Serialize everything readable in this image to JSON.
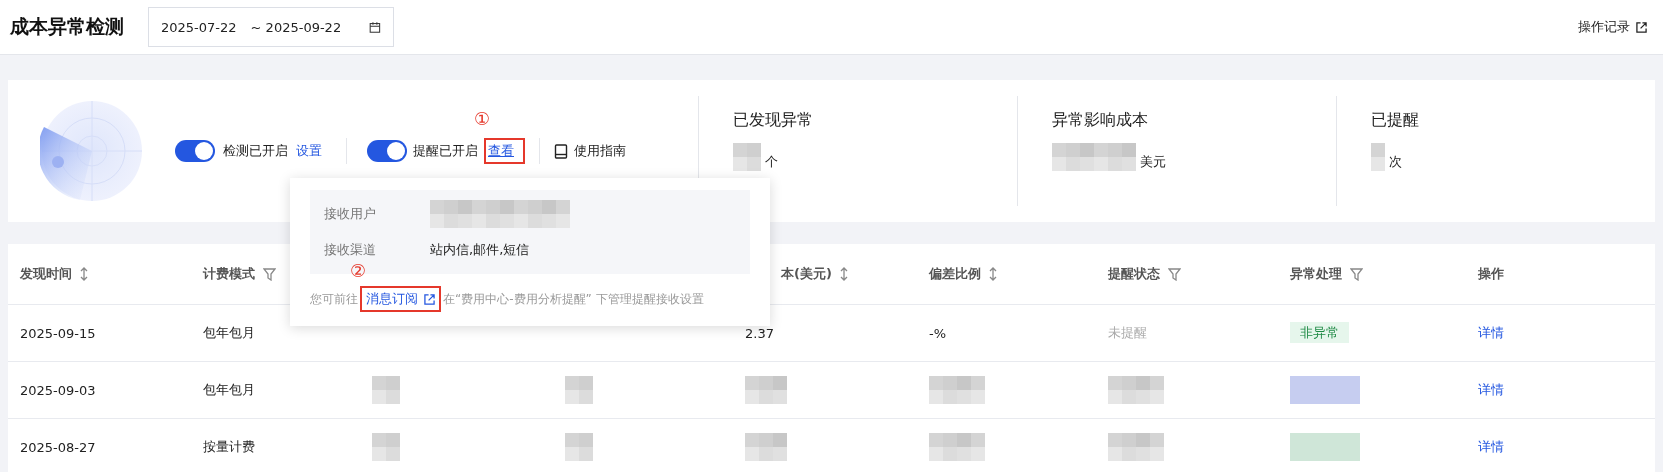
{
  "header": {
    "title": "成本异常检测",
    "date_range": {
      "start": "2025-07-22",
      "separator": "~",
      "end": "2025-09-22"
    },
    "log_link": "操作记录"
  },
  "summary": {
    "detection": {
      "on": true,
      "label": "检测已开启",
      "link": "设置"
    },
    "reminder": {
      "on": true,
      "label": "提醒已开启",
      "link": "查看",
      "annotation": "①"
    },
    "guide": "使用指南",
    "stats": [
      {
        "title": "已发现异常",
        "unit": "个"
      },
      {
        "title": "异常影响成本",
        "unit": "美元"
      },
      {
        "title": "已提醒",
        "unit": "次"
      }
    ]
  },
  "popover": {
    "rows": [
      {
        "label": "接收用户"
      },
      {
        "label": "接收渠道",
        "value": "站内信,邮件,短信"
      }
    ],
    "footer_before": "您可前往",
    "link": "消息订阅",
    "annotation": "②",
    "footer_after": "在“费用中心-费用分析提醒” 下管理提醒接收设置"
  },
  "table": {
    "columns": [
      {
        "label": "发现时间"
      },
      {
        "label": "计费模式"
      },
      {},
      {},
      {
        "label": "本(美元)"
      },
      {
        "label": "偏差比例"
      },
      {
        "label": "提醒状态"
      },
      {
        "label": "异常处理"
      },
      {
        "label": "操作"
      }
    ],
    "rows": [
      {
        "time": "2025-09-15",
        "billing": "包年包月",
        "cost": "2.37",
        "deviation": "-%",
        "reminder": "未提醒",
        "handling": {
          "kind": "tag",
          "text": "非异常"
        },
        "action": "详情"
      },
      {
        "time": "2025-09-03",
        "billing": "包年包月",
        "handling": {
          "kind": "redacted",
          "color": "#c6cdf0"
        },
        "action": "详情"
      },
      {
        "time": "2025-08-27",
        "billing": "按量计费",
        "handling": {
          "kind": "redacted",
          "color": "#cfe6d8"
        },
        "action": "详情"
      }
    ]
  }
}
